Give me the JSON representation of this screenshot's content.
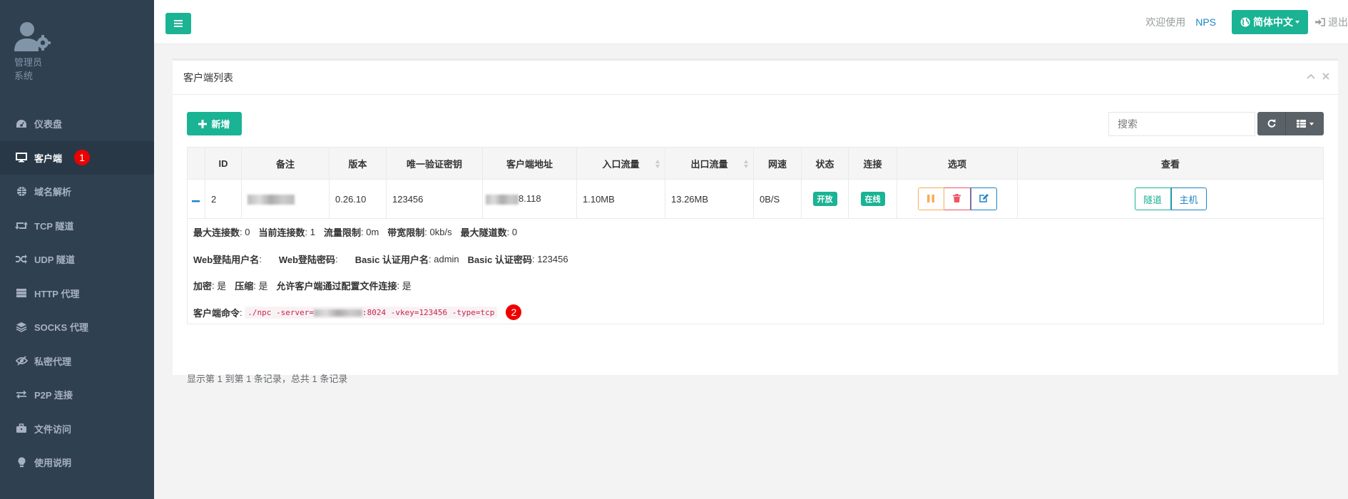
{
  "sidebar": {
    "role_line1": "管理员",
    "role_line2": "系统",
    "items": [
      {
        "label": "仪表盘",
        "icon": "dashboard-icon"
      },
      {
        "label": "客户端",
        "icon": "monitor-icon",
        "badge": "1",
        "active": true
      },
      {
        "label": "域名解析",
        "icon": "globe-icon"
      },
      {
        "label": "TCP 隧道",
        "icon": "retweet-icon"
      },
      {
        "label": "UDP 隧道",
        "icon": "shuffle-icon"
      },
      {
        "label": "HTTP 代理",
        "icon": "server-icon"
      },
      {
        "label": "SOCKS 代理",
        "icon": "layers-icon"
      },
      {
        "label": "私密代理",
        "icon": "eye-slash-icon"
      },
      {
        "label": "P2P 连接",
        "icon": "exchange-icon"
      },
      {
        "label": "文件访问",
        "icon": "briefcase-icon"
      },
      {
        "label": "使用说明",
        "icon": "lightbulb-icon"
      }
    ]
  },
  "topbar": {
    "welcome": "欢迎使用",
    "brand": "NPS",
    "language": "简体中文",
    "logout": "退出"
  },
  "panel": {
    "title": "客户端列表",
    "add_label": "新增",
    "search_placeholder": "搜索"
  },
  "table": {
    "headers": [
      "ID",
      "备注",
      "版本",
      "唯一验证密钥",
      "客户端地址",
      "入口流量",
      "出口流量",
      "网速",
      "状态",
      "连接",
      "选项",
      "查看"
    ],
    "row": {
      "id": "2",
      "version": "0.26.10",
      "vkey": "123456",
      "address_suffix": "8.118",
      "in_flow": "1.10MB",
      "out_flow": "13.26MB",
      "speed": "0B/S",
      "status": "开放",
      "connection": "在线",
      "view_tunnel": "隧道",
      "view_host": "主机"
    }
  },
  "detail": {
    "max_conn_label": "最大连接数",
    "max_conn": "0",
    "cur_conn_label": "当前连接数",
    "cur_conn": "1",
    "flow_limit_label": "流量限制",
    "flow_limit": "0m",
    "rate_limit_label": "带宽限制",
    "rate_limit": "0kb/s",
    "max_tunnel_label": "最大隧道数",
    "max_tunnel": "0",
    "web_user_label": "Web登陆用户名",
    "web_pass_label": "Web登陆密码",
    "basic_user_label": "Basic 认证用户名",
    "basic_user": "admin",
    "basic_pass_label": "Basic 认证密码",
    "basic_pass": "123456",
    "crypt_label": "加密",
    "crypt": "是",
    "compress_label": "压缩",
    "compress": "是",
    "config_conn_label": "允许客户端通过配置文件连接",
    "config_conn": "是",
    "cmd_label": "客户端命令",
    "cmd_prefix": "./npc -server=",
    "cmd_suffix": ":8024 -vkey=123456 -type=tcp",
    "badge": "2"
  },
  "footer": {
    "info": "显示第 1 到第 1 条记录，总共 1 条记录"
  }
}
